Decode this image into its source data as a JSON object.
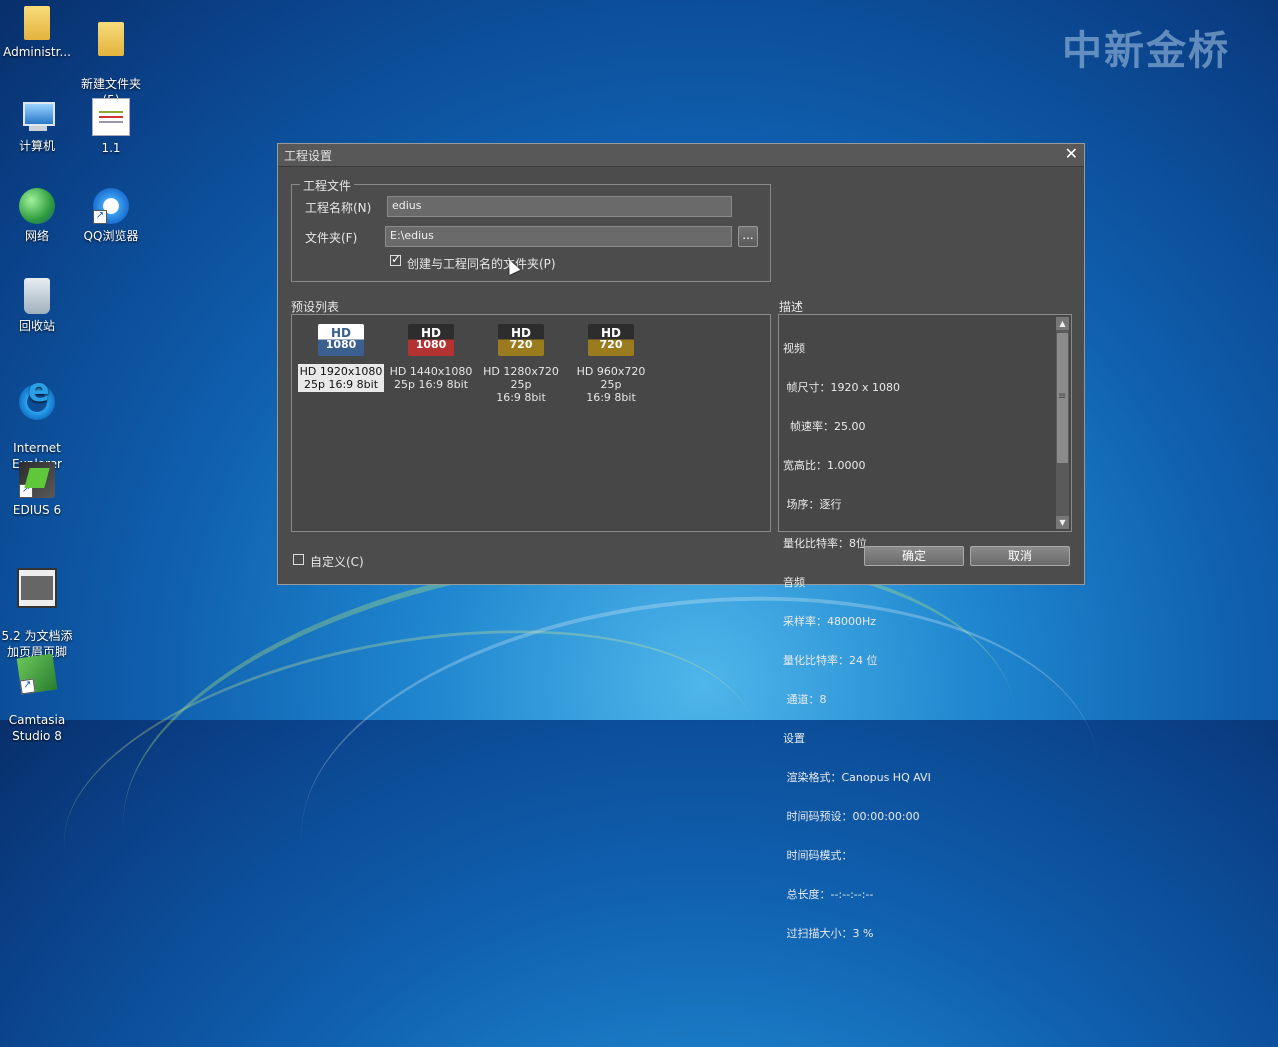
{
  "desktop": {
    "watermark": "中新金桥",
    "icons": [
      {
        "label": "Administr...",
        "icon": "folder-user-icon"
      },
      {
        "label": "新建文件夹\n(5)",
        "icon": "folder-icon"
      },
      {
        "label": "计算机",
        "icon": "computer-icon"
      },
      {
        "label": "1.1",
        "icon": "document-icon"
      },
      {
        "label": "网络",
        "icon": "network-icon"
      },
      {
        "label": "QQ浏览器",
        "icon": "qq-browser-icon"
      },
      {
        "label": "回收站",
        "icon": "recycle-bin-icon"
      },
      {
        "label": "Internet\nExplorer",
        "icon": "internet-explorer-icon"
      },
      {
        "label": "EDIUS 6",
        "icon": "edius-icon"
      },
      {
        "label": "5.2 为文档添\n加页眉页脚",
        "icon": "video-file-icon"
      },
      {
        "label": "Camtasia\nStudio 8",
        "icon": "camtasia-icon"
      }
    ]
  },
  "dialog": {
    "title": "工程设置",
    "close_symbol": "✕",
    "project_file": {
      "legend": "工程文件",
      "name_label": "工程名称(N)",
      "name_value": "edius",
      "folder_label": "文件夹(F)",
      "folder_value": "E:\\edius",
      "browse_label": "...",
      "create_folder_label": "创建与工程同名的文件夹(P)",
      "create_folder_checked": true
    },
    "preset_list": {
      "label": "预设列表",
      "presets": [
        {
          "top": "HD",
          "bottom": "1080",
          "line1": "HD 1920x1080",
          "line2": "25p 16:9 8bit",
          "selected": true,
          "color": "#3b5f8f"
        },
        {
          "top": "HD",
          "bottom": "1080",
          "line1": "HD 1440x1080",
          "line2": "25p 16:9 8bit",
          "selected": false,
          "color": "#a33030"
        },
        {
          "top": "HD",
          "bottom": "720",
          "line1": "HD 1280x720 25p",
          "line2": "16:9 8bit",
          "selected": false,
          "color": "#8a7420"
        },
        {
          "top": "HD",
          "bottom": "720",
          "line1": "HD 960x720 25p",
          "line2": "16:9 8bit",
          "selected": false,
          "color": "#8a7420"
        }
      ]
    },
    "description": {
      "label": "描述",
      "lines": [
        "视频",
        " 帧尺寸：1920 x 1080",
        "  帧速率：25.00",
        "宽高比：1.0000",
        " 场序：逐行",
        "量化比特率：8位",
        "音频",
        "采样率：48000Hz",
        "量化比特率：24 位",
        " 通道：8",
        "设置",
        " 渲染格式：Canopus HQ AVI",
        " 时间码预设：00:00:00:00",
        " 时间码模式：",
        " 总长度：--:--:--:--",
        " 过扫描大小：3 %"
      ]
    },
    "custom_label": "自定义(C)",
    "custom_checked": false,
    "ok_label": "确定",
    "cancel_label": "取消"
  }
}
